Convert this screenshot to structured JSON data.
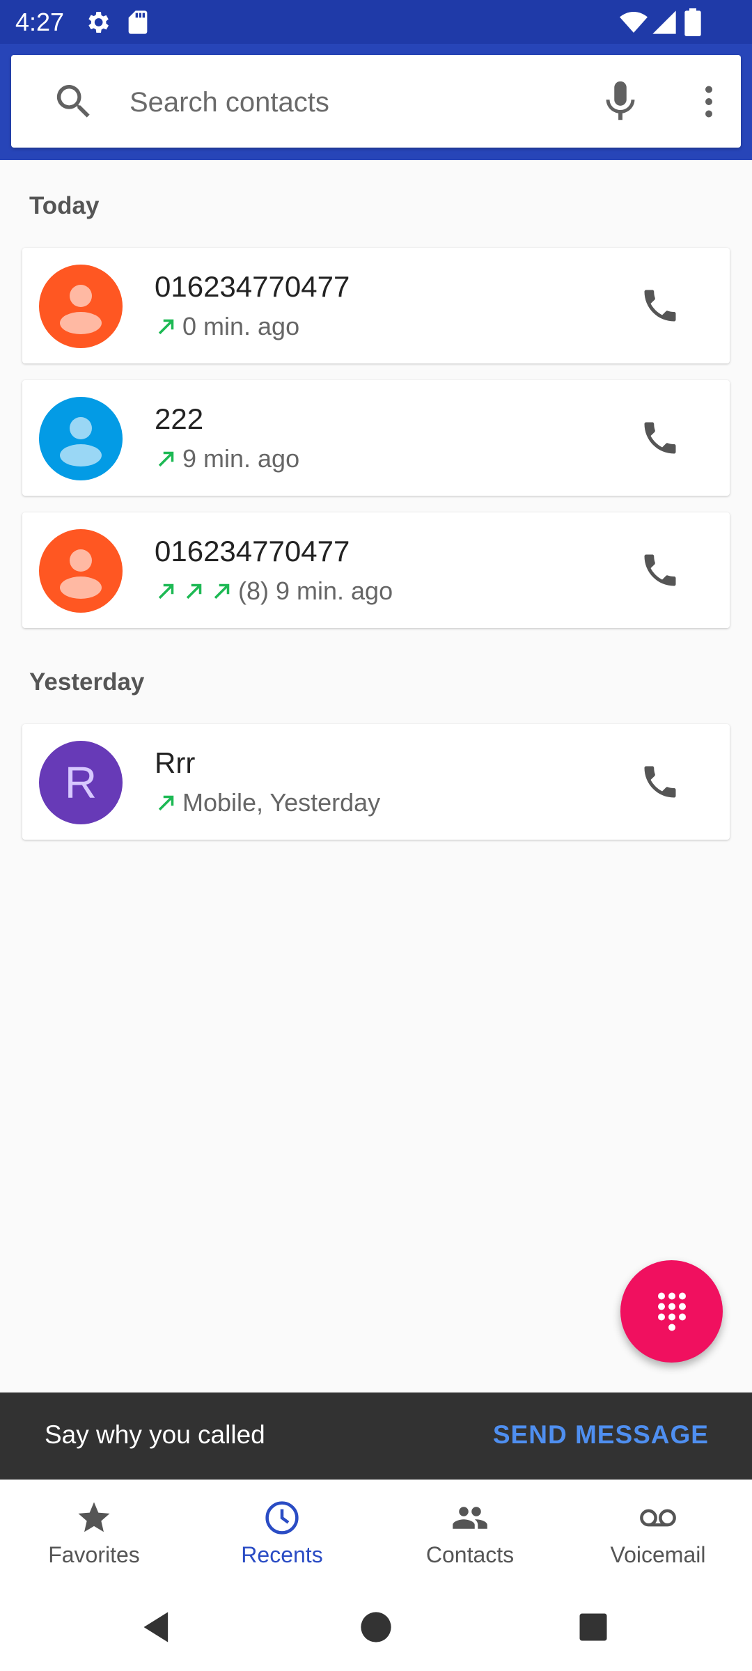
{
  "status_bar": {
    "time": "4:27"
  },
  "search": {
    "placeholder": "Search contacts"
  },
  "sections": [
    {
      "header": "Today",
      "calls": [
        {
          "name": "016234770477",
          "detail": "0 min. ago",
          "arrows": 1,
          "avatar_color": "#ff5722",
          "avatar_type": "person"
        },
        {
          "name": "222",
          "detail": "9 min. ago",
          "arrows": 1,
          "avatar_color": "#039be5",
          "avatar_type": "person"
        },
        {
          "name": "016234770477",
          "detail": "(8) 9 min. ago",
          "arrows": 3,
          "avatar_color": "#ff5722",
          "avatar_type": "person"
        }
      ]
    },
    {
      "header": "Yesterday",
      "calls": [
        {
          "name": "Rrr",
          "detail": "Mobile, Yesterday",
          "arrows": 1,
          "avatar_color": "#673ab7",
          "avatar_type": "letter",
          "avatar_letter": "R"
        }
      ]
    }
  ],
  "snackbar": {
    "text": "Say why you called",
    "action": "SEND MESSAGE"
  },
  "bottom_nav": [
    {
      "label": "Favorites",
      "icon": "star-icon",
      "active": false
    },
    {
      "label": "Recents",
      "icon": "clock-icon",
      "active": true
    },
    {
      "label": "Contacts",
      "icon": "people-icon",
      "active": false
    },
    {
      "label": "Voicemail",
      "icon": "voicemail-icon",
      "active": false
    }
  ],
  "colors": {
    "header": "#2745b8",
    "accent": "#2a4cc4",
    "fab": "#f0105f",
    "outgoing_arrow": "#1db954",
    "snackbar_action": "#4f8ff0"
  }
}
